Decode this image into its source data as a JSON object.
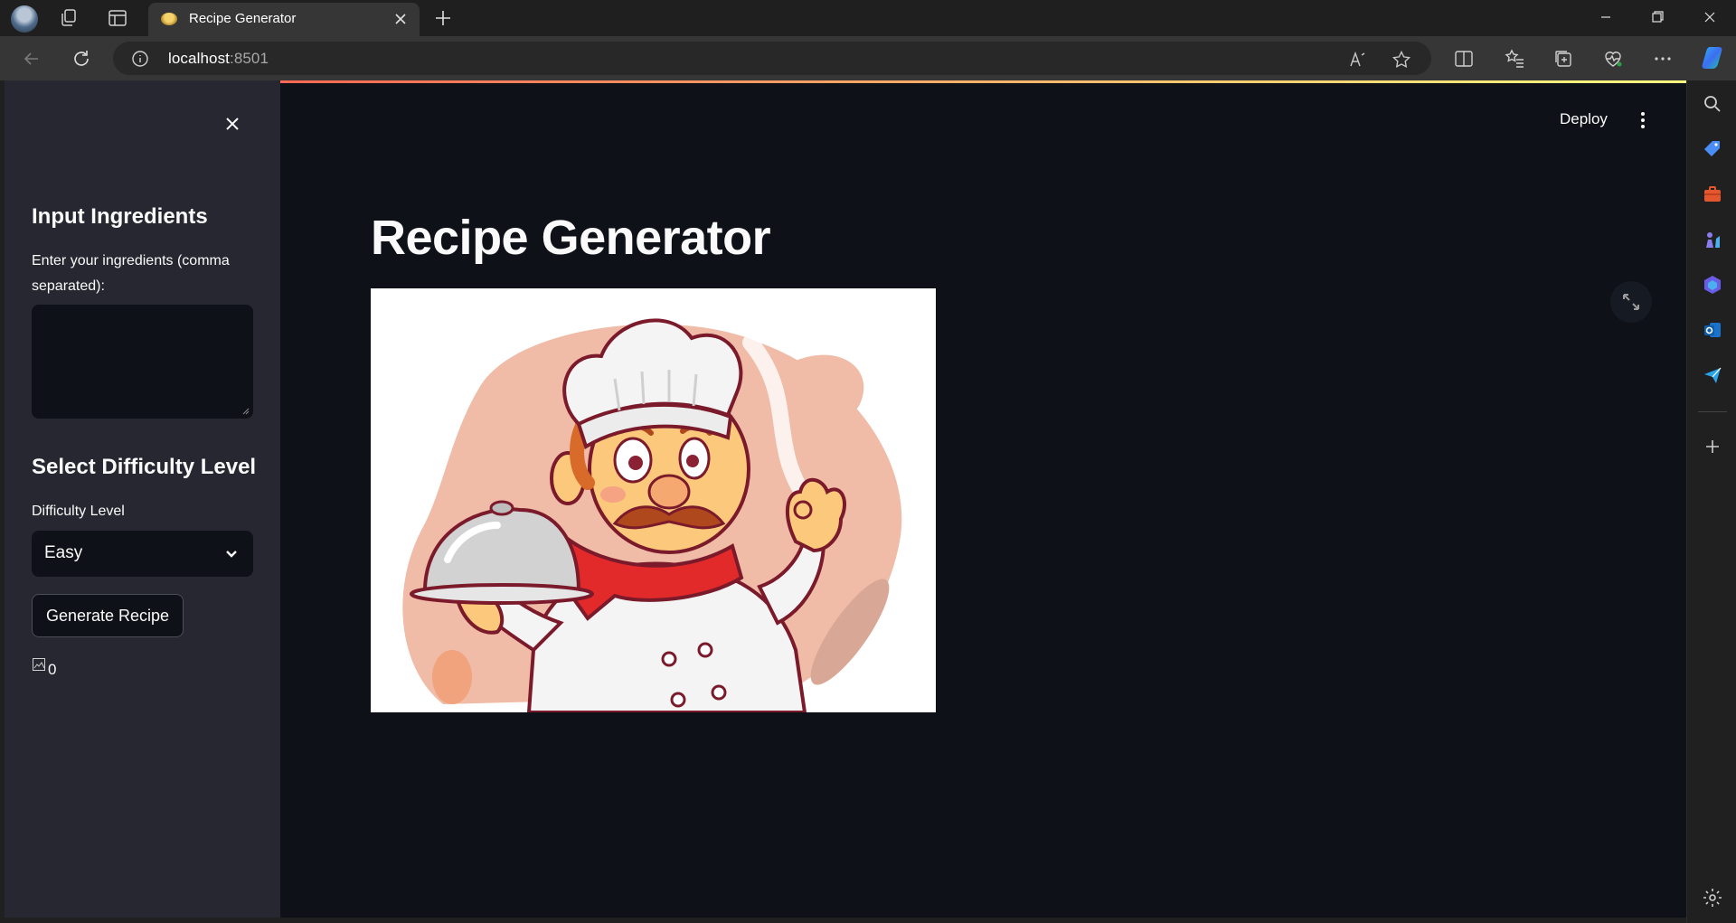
{
  "browser": {
    "tab_title": "Recipe Generator",
    "url_host": "localhost",
    "url_port": ":8501"
  },
  "app": {
    "deploy_label": "Deploy",
    "title": "Recipe Generator",
    "hero_image_icon": "chef-illustration"
  },
  "sidebar": {
    "ingredients_heading": "Input Ingredients",
    "ingredients_label": "Enter your ingredients (comma separated):",
    "ingredients_value": "",
    "difficulty_heading": "Select Difficulty Level",
    "difficulty_label": "Difficulty Level",
    "difficulty_value": "Easy",
    "generate_button": "Generate Recipe",
    "broken_image_alt": "0"
  },
  "colors": {
    "app_bg": "#0e1117",
    "sidebar_bg": "#262730",
    "text": "#fafafa",
    "accent_gradient_start": "#ff4b4b",
    "accent_gradient_end": "#fffd80"
  }
}
